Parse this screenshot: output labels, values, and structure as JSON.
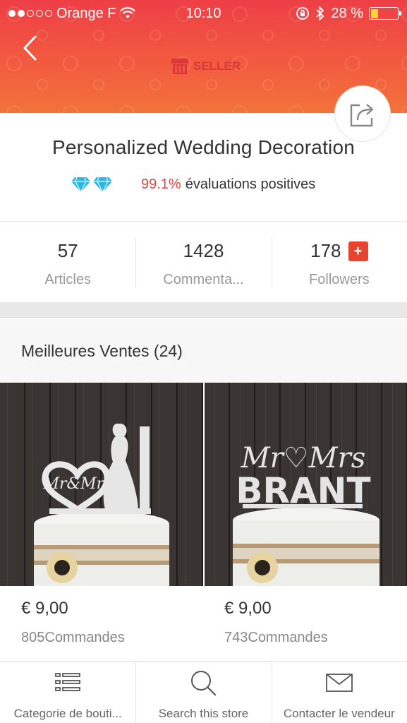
{
  "status_bar": {
    "carrier": "Orange F",
    "time": "10:10",
    "battery_pct": "28 %",
    "battery_level": 0.28
  },
  "header": {
    "badge": "SELLER"
  },
  "store": {
    "name": "Personalized Wedding Decoration",
    "diamond_count": 2,
    "rating_pct": "99.1%",
    "rating_text": "évaluations positives"
  },
  "stats": [
    {
      "value": "57",
      "label": "Articles"
    },
    {
      "value": "1428",
      "label": "Commenta..."
    },
    {
      "value": "178",
      "label": "Followers",
      "badge": "+"
    }
  ],
  "section": {
    "title": "Meilleures Ventes (24)"
  },
  "products": [
    {
      "price": "€ 9,00",
      "orders": "805Commandes",
      "topper_text": "Mr&Mrs"
    },
    {
      "price": "€ 9,00",
      "orders": "743Commandes",
      "topper_text": "Mr♡Mrs BRANT"
    }
  ],
  "tabs": [
    {
      "label": "Categorie de bouti...",
      "icon": "list-icon"
    },
    {
      "label": "Search this store",
      "icon": "search-icon"
    },
    {
      "label": "Contacter le vendeur",
      "icon": "mail-icon"
    }
  ],
  "colors": {
    "accent": "#e8453c",
    "banner_top": "#ee3f47",
    "banner_bottom": "#f2733a",
    "diamond": "#2bb8e8"
  }
}
